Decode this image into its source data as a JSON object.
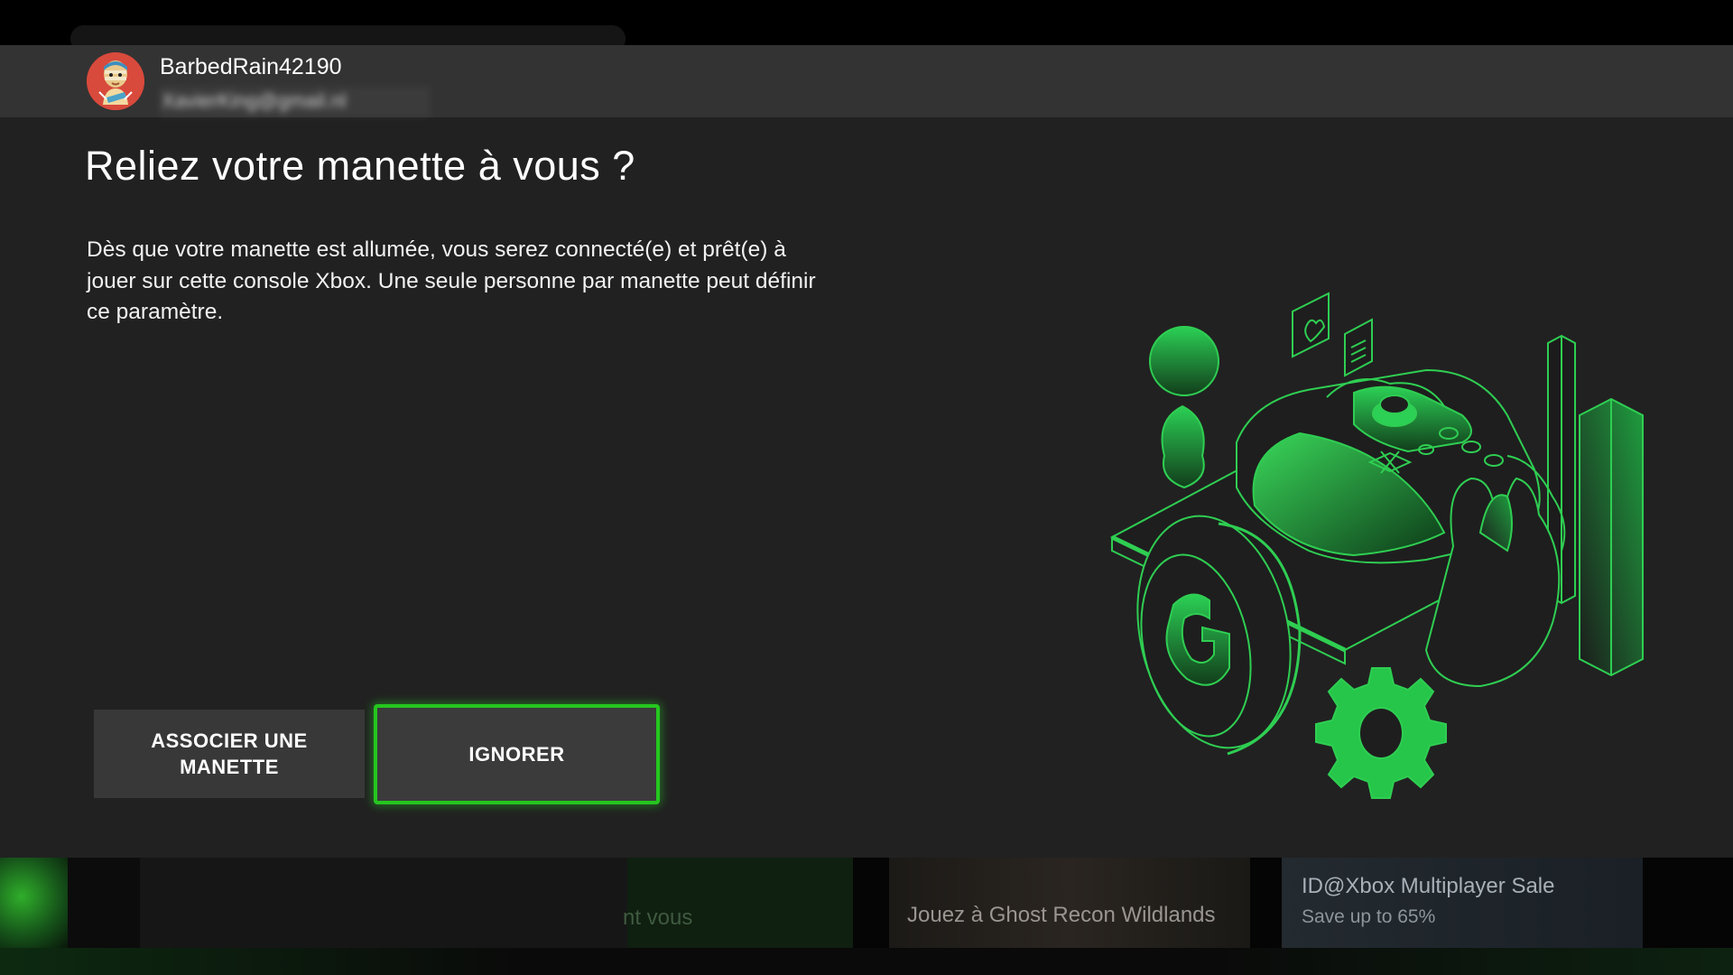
{
  "account": {
    "gamertag": "BarbedRain42190",
    "email": "XavierKing@gmail.nl"
  },
  "dialog": {
    "title": "Reliez votre manette à vous ?",
    "description": "Dès que votre manette est allumée, vous serez connecté(e) et prêt(e) à jouer sur cette console Xbox. Une seule personne par manette peut définir ce paramètre.",
    "buttons": {
      "pair_label": "ASSOCIER UNE MANETTE",
      "ignore_label": "IGNORER"
    }
  },
  "background": {
    "tile_text_1": "nt vous",
    "tile_text_2": "Jouez à Ghost Recon Wildlands",
    "tile_text_3": "ID@Xbox Multiplayer Sale",
    "tile_text_4": "Save up to 65%"
  },
  "colors": {
    "accent": "#25c61f",
    "modal_bg": "#212121",
    "account_bar_bg": "#333333"
  },
  "icons": [
    "avatar",
    "controller-illustration"
  ]
}
